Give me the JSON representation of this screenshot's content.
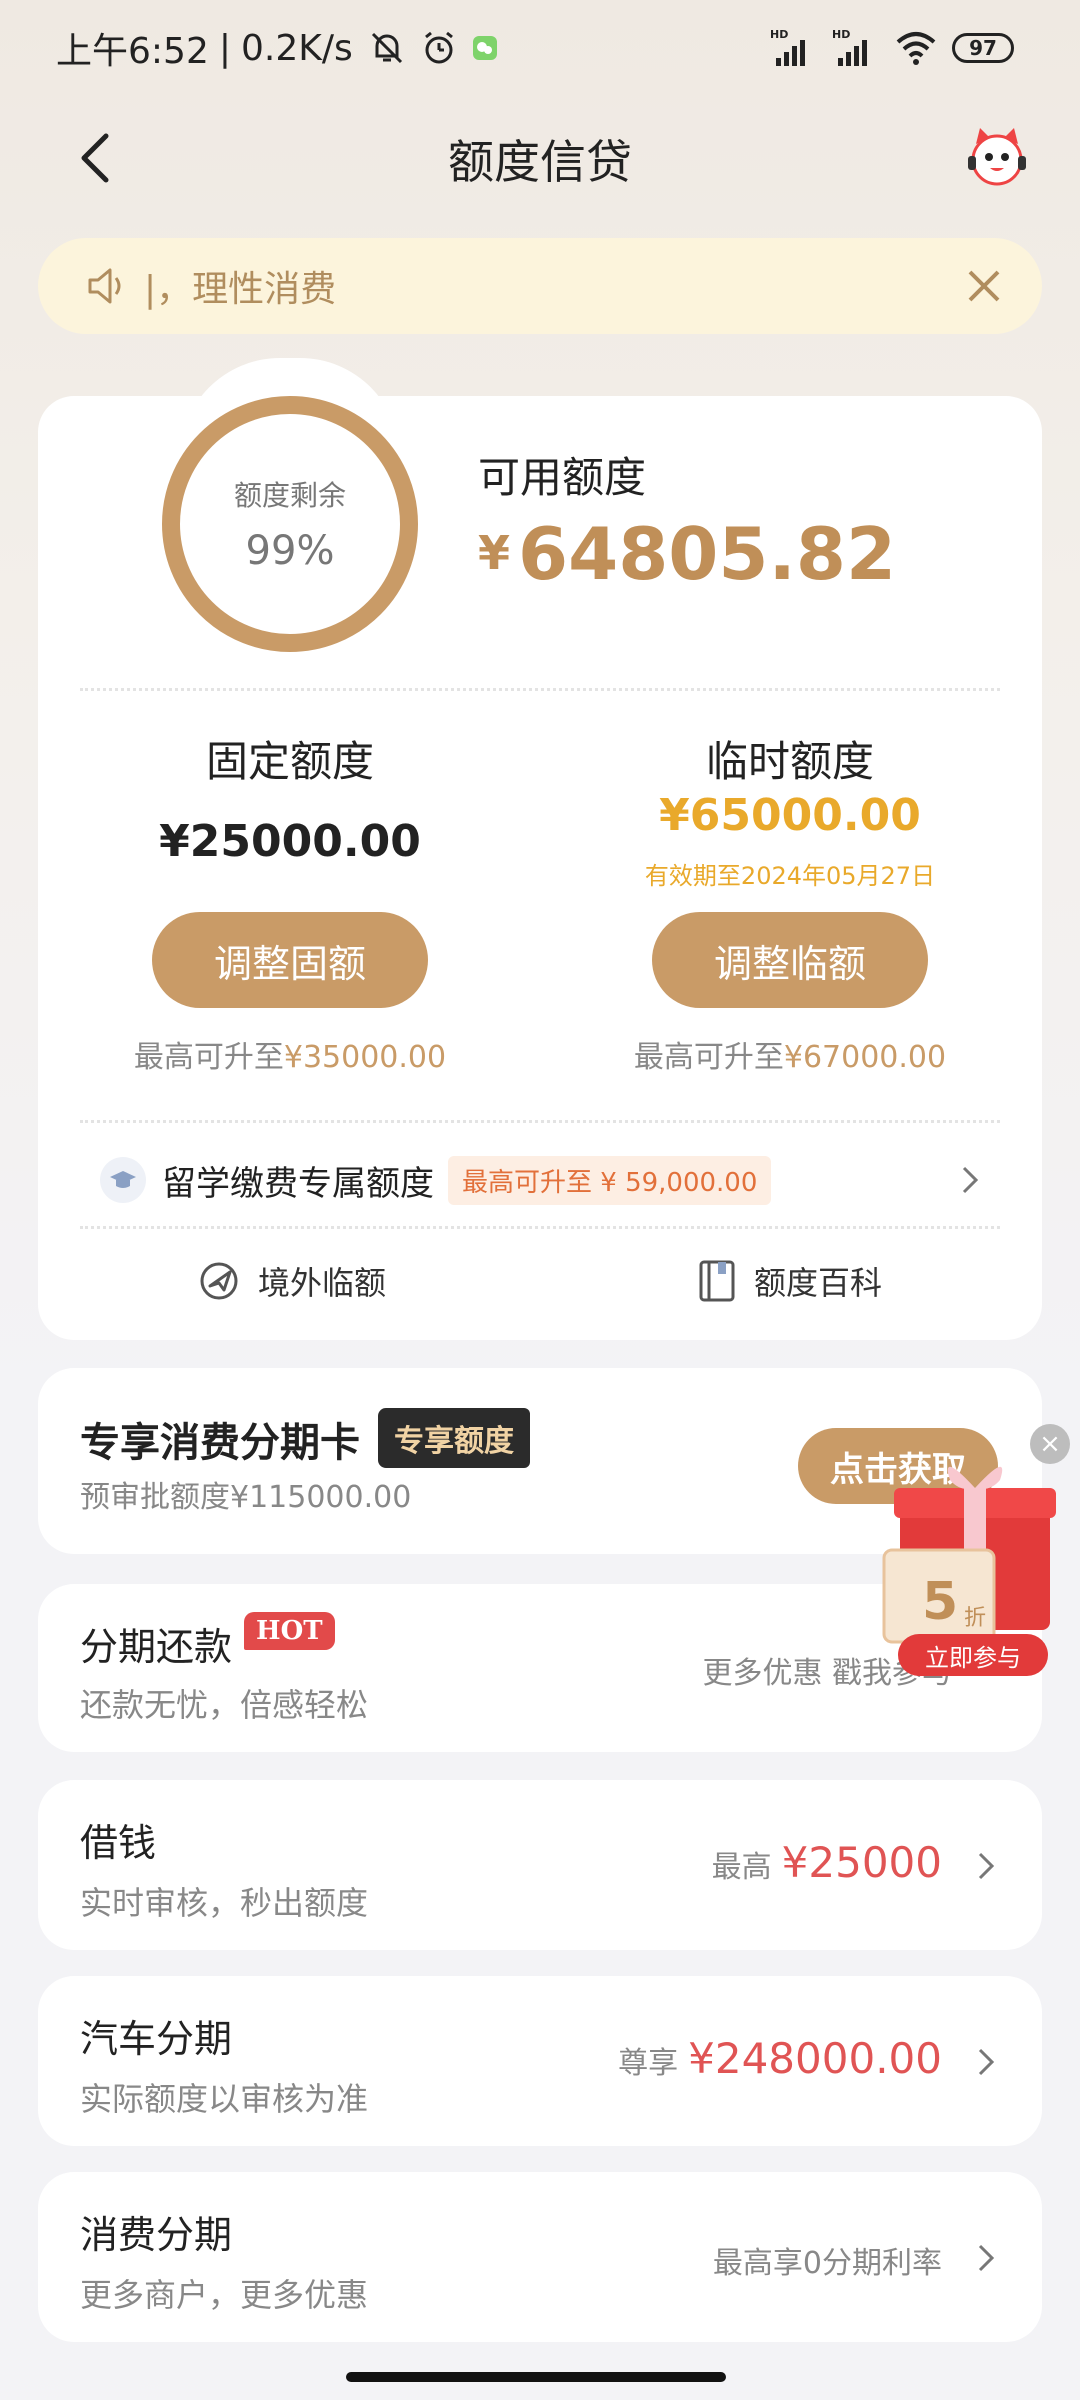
{
  "status_bar": {
    "time": "上午6:52",
    "speed": "0.2K/s",
    "battery": "97",
    "signal1_label": "HD",
    "signal2_label": "HD"
  },
  "header": {
    "title": "额度信贷"
  },
  "notice": {
    "text": "|，理性消费"
  },
  "credit": {
    "ring_label": "额度剩余",
    "ring_percent": "99%",
    "ring_fraction": 0.99,
    "available_label": "可用额度",
    "currency": "¥",
    "available_value": "64805.82",
    "fixed": {
      "title": "固定额度",
      "value": "¥25000.00",
      "button": "调整固额",
      "max_prefix": "最高可升至",
      "max_amount": "¥35000.00"
    },
    "temporary": {
      "title": "临时额度",
      "value": "¥65000.00",
      "validity": "有效期至2024年05月27日",
      "button": "调整临额",
      "max_prefix": "最高可升至",
      "max_amount": "¥67000.00"
    },
    "study_abroad": {
      "label": "留学缴费专属额度",
      "tag": "最高可升至 ¥ 59,000.00"
    },
    "links": {
      "overseas": "境外临额",
      "encyclopedia": "额度百科"
    }
  },
  "exclusive_card": {
    "title": "专享消费分期卡",
    "tag": "专享额度",
    "subtitle": "预审批额度¥115000.00",
    "button": "点击获取"
  },
  "installment_repay": {
    "title": "分期还款",
    "badge": "HOT",
    "subtitle": "还款无忧，倍感轻松",
    "right_text": "更多优惠 戳我参与"
  },
  "borrow": {
    "title": "借钱",
    "subtitle": "实时审核，秒出额度",
    "right_prefix": "最高",
    "right_amount": "¥25000"
  },
  "car_loan": {
    "title": "汽车分期",
    "subtitle": "实际额度以审核为准",
    "right_prefix": "尊享",
    "right_amount": "¥248000.00"
  },
  "consumer_installment": {
    "title": "消费分期",
    "subtitle": "更多商户，更多优惠",
    "right_text": "最高享0分期利率"
  },
  "promo": {
    "discount": "5",
    "discount_unit": "折",
    "button": "立即参与",
    "close": "×"
  },
  "colors": {
    "accent": "#c99b67",
    "gold": "#e9a92b",
    "red": "#e05454"
  }
}
